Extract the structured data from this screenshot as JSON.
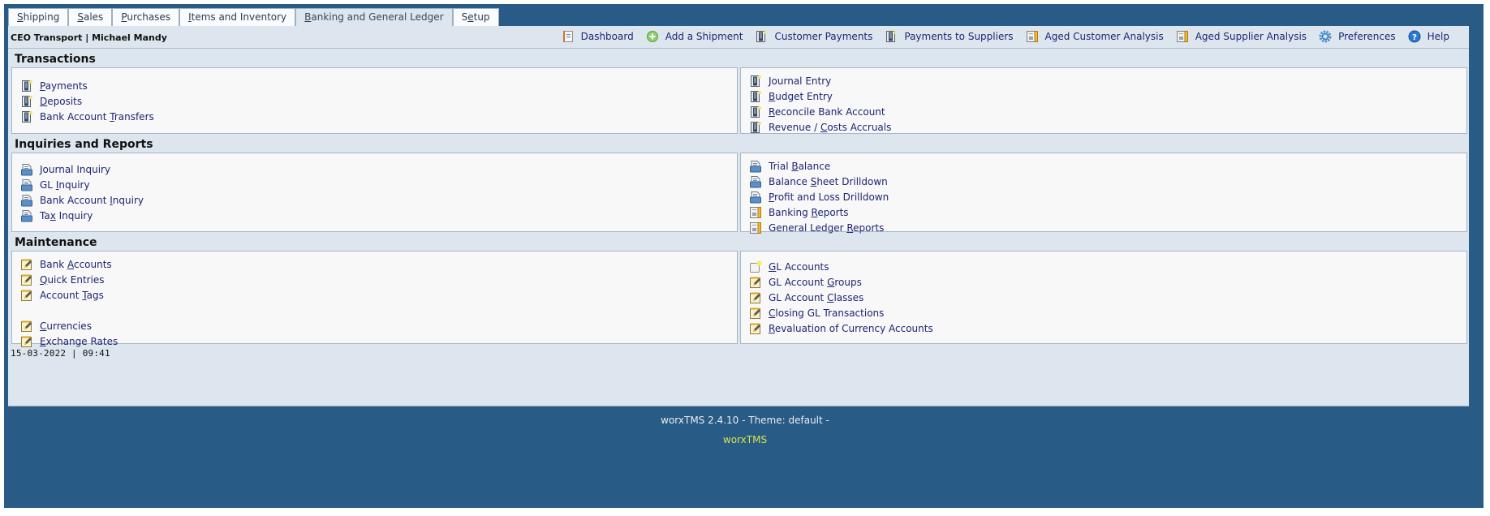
{
  "tabs": [
    {
      "label": "Shipping",
      "accesskey_index": 0,
      "active": false
    },
    {
      "label": "Sales",
      "accesskey_index": 0,
      "active": false
    },
    {
      "label": "Purchases",
      "accesskey_index": 0,
      "active": false
    },
    {
      "label": "Items and Inventory",
      "accesskey_index": 0,
      "active": false
    },
    {
      "label": "Banking and General Ledger",
      "accesskey_index": 0,
      "active": true
    },
    {
      "label": "Setup",
      "accesskey_index": 1,
      "active": false
    }
  ],
  "header": {
    "company_user": "CEO Transport | Michael Mandy"
  },
  "shortcuts": [
    {
      "label": "Dashboard",
      "icon": "dashboard-icon"
    },
    {
      "label": "Add a Shipment",
      "icon": "add-icon"
    },
    {
      "label": "Customer Payments",
      "icon": "binder-icon"
    },
    {
      "label": "Payments to Suppliers",
      "icon": "binder-icon"
    },
    {
      "label": "Aged Customer Analysis",
      "icon": "report-icon"
    },
    {
      "label": "Aged Supplier Analysis",
      "icon": "report-icon"
    },
    {
      "label": "Preferences",
      "icon": "gear-icon"
    },
    {
      "label": "Help",
      "icon": "help-icon"
    }
  ],
  "sections": [
    {
      "title": "Transactions",
      "left": [
        {
          "label": "Payments",
          "u": 0,
          "icon": "binder-icon"
        },
        {
          "label": "Deposits",
          "u": 0,
          "icon": "binder-icon"
        },
        {
          "label": "Bank Account Transfers",
          "u": 13,
          "icon": "binder-icon"
        }
      ],
      "right": [
        {
          "label": "Journal Entry",
          "u": 0,
          "icon": "binder-icon"
        },
        {
          "label": "Budget Entry",
          "u": 0,
          "icon": "binder-icon"
        },
        {
          "label": "Reconcile Bank Account",
          "u": 0,
          "icon": "binder-icon"
        },
        {
          "label": "Revenue / Costs Accruals",
          "u": 10,
          "icon": "binder-icon"
        }
      ]
    },
    {
      "title": "Inquiries and Reports",
      "left": [
        {
          "label": "Journal Inquiry",
          "u": 0,
          "icon": "inquiry-icon"
        },
        {
          "label": "GL Inquiry",
          "u": 3,
          "icon": "inquiry-icon"
        },
        {
          "label": "Bank Account Inquiry",
          "u": 13,
          "icon": "inquiry-icon"
        },
        {
          "label": "Tax Inquiry",
          "u": 2,
          "icon": "inquiry-icon"
        }
      ],
      "right": [
        {
          "label": "Trial Balance",
          "u": 6,
          "icon": "inquiry-icon"
        },
        {
          "label": "Balance Sheet Drilldown",
          "u": 8,
          "icon": "inquiry-icon"
        },
        {
          "label": "Profit and Loss Drilldown",
          "u": 0,
          "icon": "inquiry-icon"
        },
        {
          "label": "Banking Reports",
          "u": 8,
          "icon": "report-icon"
        },
        {
          "label": "General Ledger Reports",
          "u": 15,
          "icon": "report-icon"
        }
      ]
    },
    {
      "title": "Maintenance",
      "left": [
        {
          "label": "Bank Accounts",
          "u": 5,
          "icon": "edit-icon"
        },
        {
          "label": "Quick Entries",
          "u": 0,
          "icon": "edit-icon"
        },
        {
          "label": "Account Tags",
          "u": 8,
          "icon": "edit-icon"
        },
        {
          "spacer": true
        },
        {
          "label": "Currencies",
          "u": 0,
          "icon": "edit-icon"
        },
        {
          "label": "Exchange Rates",
          "u": 0,
          "icon": "edit-icon"
        }
      ],
      "right": [
        {
          "label": "GL Accounts",
          "u": 0,
          "icon": "new-icon"
        },
        {
          "label": "GL Account Groups",
          "u": 11,
          "icon": "edit-icon"
        },
        {
          "label": "GL Account Classes",
          "u": 11,
          "icon": "edit-icon"
        },
        {
          "label": "Closing GL Transactions",
          "u": 0,
          "icon": "edit-icon"
        },
        {
          "label": "Revaluation of Currency Accounts",
          "u": 0,
          "icon": "edit-icon"
        }
      ]
    }
  ],
  "status": {
    "datetime": "15-03-2022 | 09:41"
  },
  "footer": {
    "version_line": "worxTMS 2.4.10 - Theme: default -",
    "brand": "worxTMS"
  },
  "colors": {
    "background": "#285b86",
    "panel": "#dde6ee",
    "box": "#f8f8f8",
    "link": "#1c2573",
    "brand_footer": "#d8e34a"
  }
}
